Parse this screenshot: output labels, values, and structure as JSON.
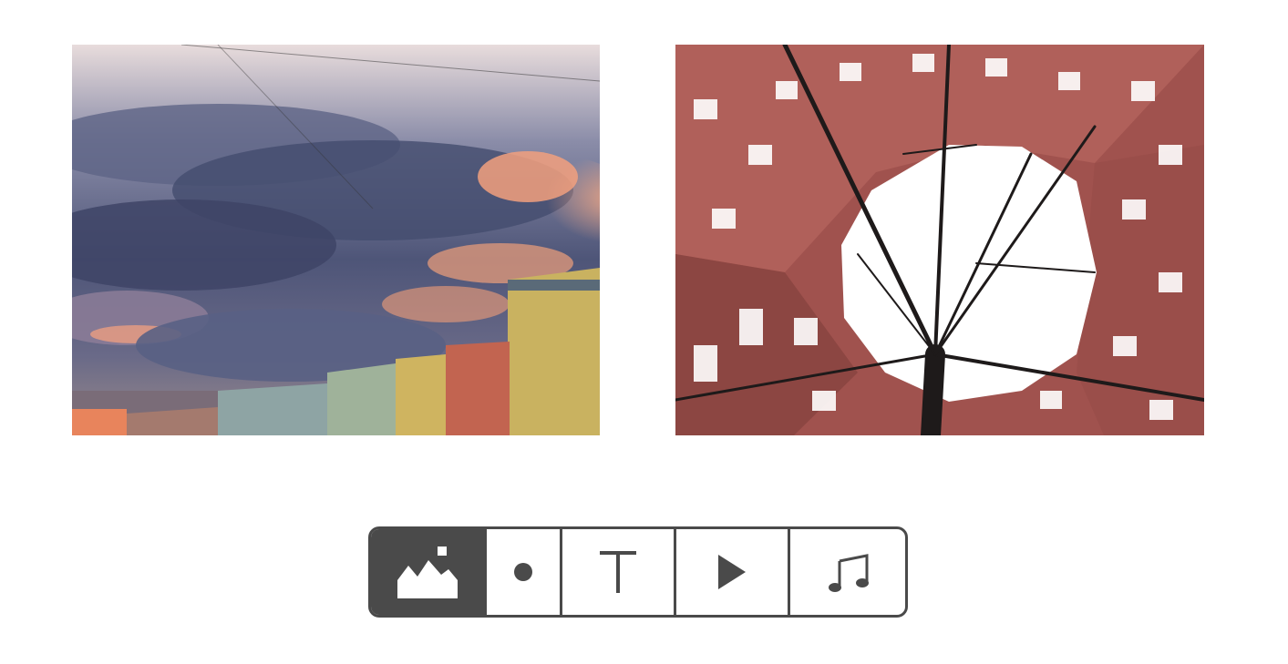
{
  "gallery": {
    "images": [
      {
        "name": "clouds-over-city-photo"
      },
      {
        "name": "courtyard-sky-photo"
      }
    ]
  },
  "toolbar": {
    "active_tool": "image",
    "tools": [
      {
        "id": "image",
        "icon": "image-icon"
      },
      {
        "id": "dot",
        "icon": "dot-icon"
      },
      {
        "id": "text",
        "icon": "text-icon"
      },
      {
        "id": "video",
        "icon": "play-icon"
      },
      {
        "id": "audio",
        "icon": "music-note-icon"
      }
    ]
  },
  "colors": {
    "toolbar_dark": "#4a4a4a",
    "background": "#ffffff"
  }
}
